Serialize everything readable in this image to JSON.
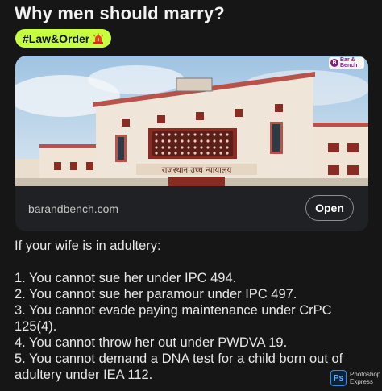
{
  "post": {
    "title": "Why men should marry?",
    "tag": "#Law&Order",
    "tag_icon": "siren-icon"
  },
  "link_card": {
    "domain": "barandbench.com",
    "open_label": "Open",
    "image_alt_logo_text": [
      "Bar &",
      "Bench"
    ],
    "building_sign": "राजस्थान उच्च न्यायालय"
  },
  "body": {
    "intro": "If your wife is in adultery:",
    "points": [
      "1. You cannot sue her under IPC 494.",
      "2. You cannot sue her paramour under IPC 497.",
      "3. You cannot evade paying maintenance under CrPC 125(4).",
      "4. You cannot throw her out under PWDVA 19.",
      "5. You cannot demand a DNA test for a child born out of adultery under IEA 112."
    ]
  },
  "watermark": {
    "icon_text": "Ps",
    "line1": "Photoshop",
    "line2": "Express"
  },
  "colors": {
    "background": "#161616",
    "tag_background": "#c5ff3f",
    "card_background": "#1f2124"
  }
}
